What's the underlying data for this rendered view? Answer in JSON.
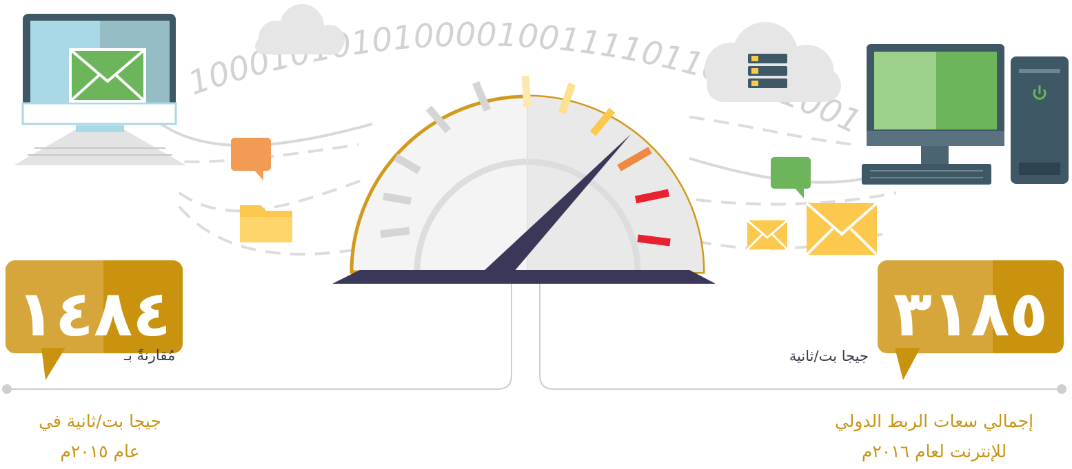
{
  "binary_stream": "1000101010100001001111011001110010100",
  "stats": [
    {
      "value": "٣١٨٥",
      "unit": "جيجا بت/ثانية",
      "caption_line1": "إجمالي سعات الربط الدولي",
      "caption_line2": "للإنترنت  لعام ٢٠١٦م"
    },
    {
      "value": "١٤٨٤",
      "unit": "مُقارنةً بـ",
      "caption_line1": "جيجا بت/ثانية في",
      "caption_line2": "عام ٢٠١٥م"
    }
  ],
  "speedometer": {
    "needle_level": 0.6
  },
  "colors": {
    "gold": "#d6a63a",
    "gold_dark": "#c9930f",
    "gold_text": "#c89414",
    "navy": "#3b3758",
    "rim": "#d19a1c",
    "cloud": "#e8e8e8",
    "orange": "#f29b55",
    "green": "#6db55b",
    "yellow": "#fcc84e",
    "red": "#e8202f"
  },
  "icons": [
    "laptop-icon",
    "envelope-icon",
    "cloud-icon",
    "server-icon",
    "chat-bubble-icon",
    "folder-icon",
    "desktop-computer-icon",
    "power-icon",
    "keyboard-icon"
  ]
}
